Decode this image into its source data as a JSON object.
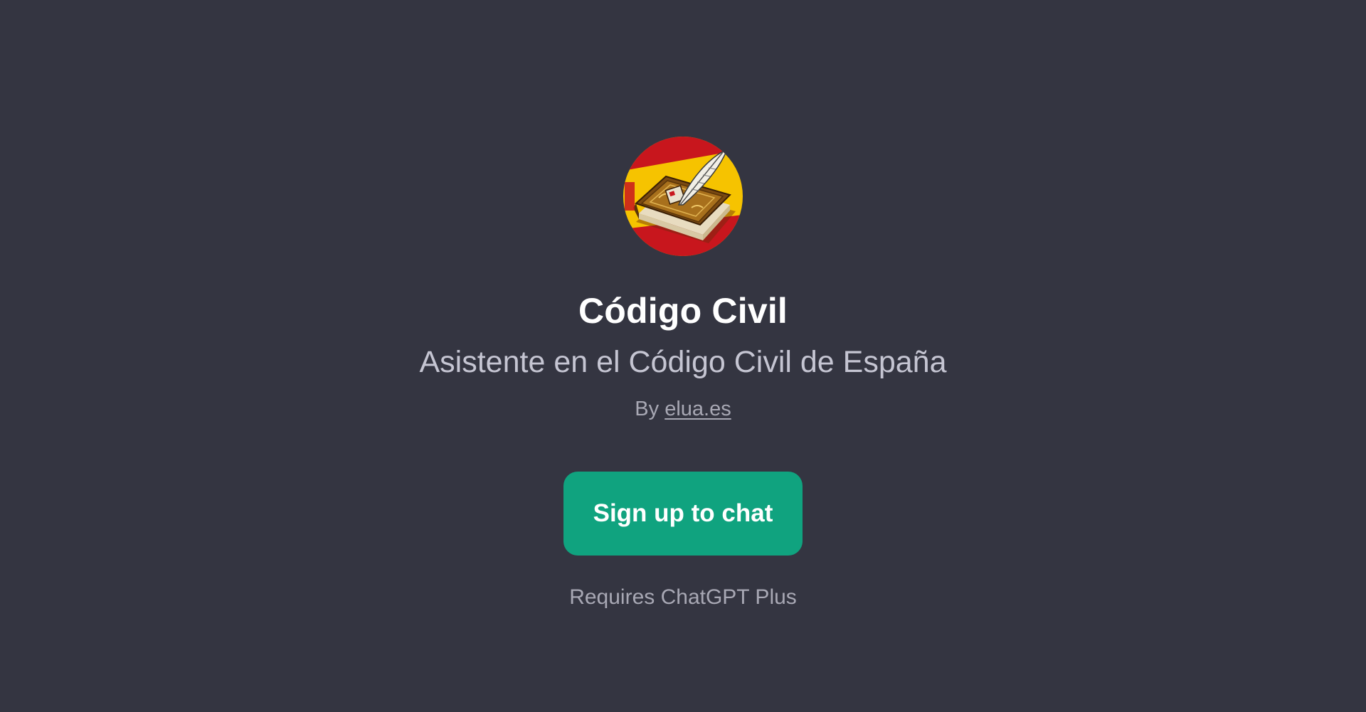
{
  "gpt": {
    "avatar_icon": "book-with-quill-spanish-flag-icon",
    "title": "Código Civil",
    "subtitle": "Asistente en el Código Civil de España",
    "by_prefix": "By",
    "author_link": "elua.es"
  },
  "actions": {
    "signup_label": "Sign up to chat",
    "requirement_note": "Requires ChatGPT Plus"
  },
  "colors": {
    "background": "#343541",
    "accent": "#10a37f",
    "flag_red": "#c8161d",
    "flag_yellow": "#f6c300"
  }
}
